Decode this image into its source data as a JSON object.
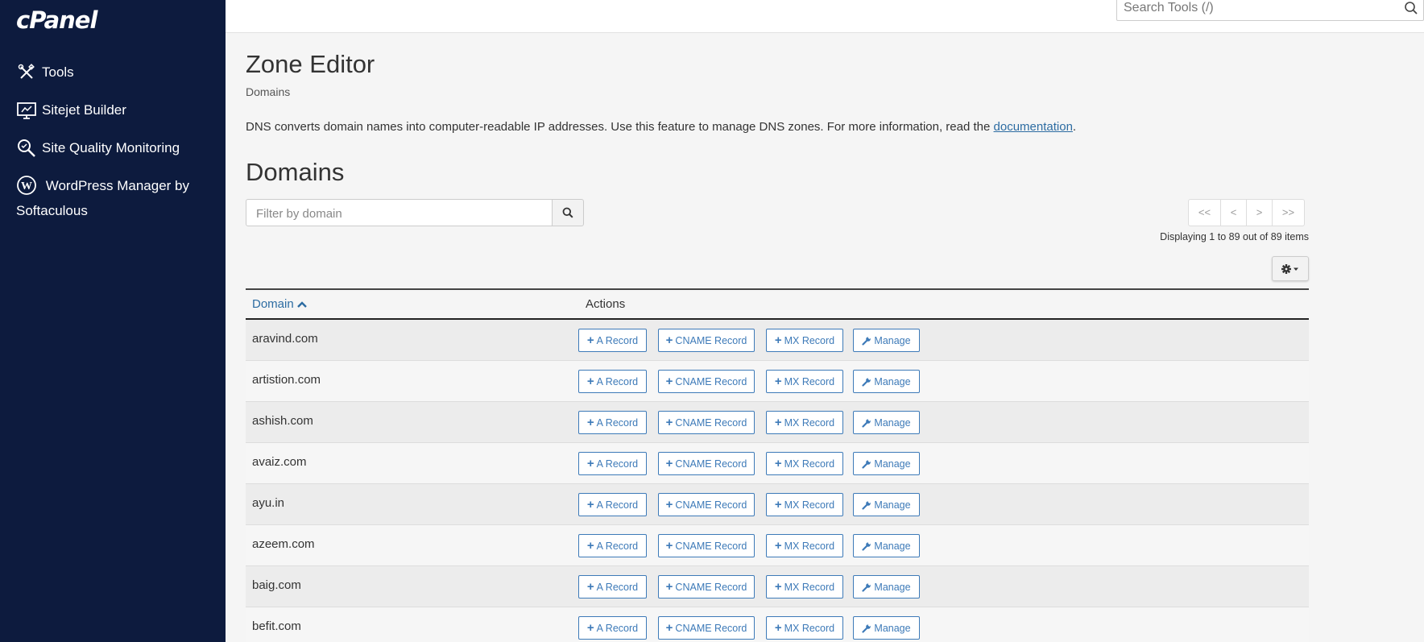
{
  "sidebar": {
    "logo": "cPanel",
    "items": [
      {
        "label": "Tools",
        "icon": "tools-icon"
      },
      {
        "label": "Sitejet Builder",
        "icon": "monitor-icon"
      },
      {
        "label": "Site Quality Monitoring",
        "icon": "magnifier-icon"
      },
      {
        "label": "WordPress Manager by Softaculous",
        "icon": "wordpress-icon"
      }
    ]
  },
  "header": {
    "search_placeholder": "Search Tools (/)"
  },
  "page": {
    "title": "Zone Editor",
    "breadcrumb": "Domains",
    "description": "DNS converts domain names into computer-readable IP addresses. Use this feature to manage DNS zones. For more information, read the",
    "description_link": "documentation",
    "description_end": ".",
    "section_title": "Domains"
  },
  "filter": {
    "placeholder": "Filter by domain"
  },
  "pagination": {
    "first": "<<",
    "prev": "<",
    "next": ">",
    "last": ">>",
    "summary": "Displaying 1 to 89 out of 89 items"
  },
  "table": {
    "columns": [
      "Domain",
      "Actions"
    ],
    "sort": "ascending",
    "action_labels": {
      "a": "A Record",
      "cname": "CNAME Record",
      "mx": "MX Record",
      "manage": "Manage"
    },
    "rows": [
      {
        "domain": "aravind.com"
      },
      {
        "domain": "artistion.com"
      },
      {
        "domain": "ashish.com"
      },
      {
        "domain": "avaiz.com"
      },
      {
        "domain": "ayu.in"
      },
      {
        "domain": "azeem.com"
      },
      {
        "domain": "baig.com"
      },
      {
        "domain": "befit.com"
      }
    ]
  },
  "colors": {
    "sidebar_bg": "#0d1b3e",
    "link": "#2d6ca2",
    "button_border": "#3d7ab8"
  }
}
